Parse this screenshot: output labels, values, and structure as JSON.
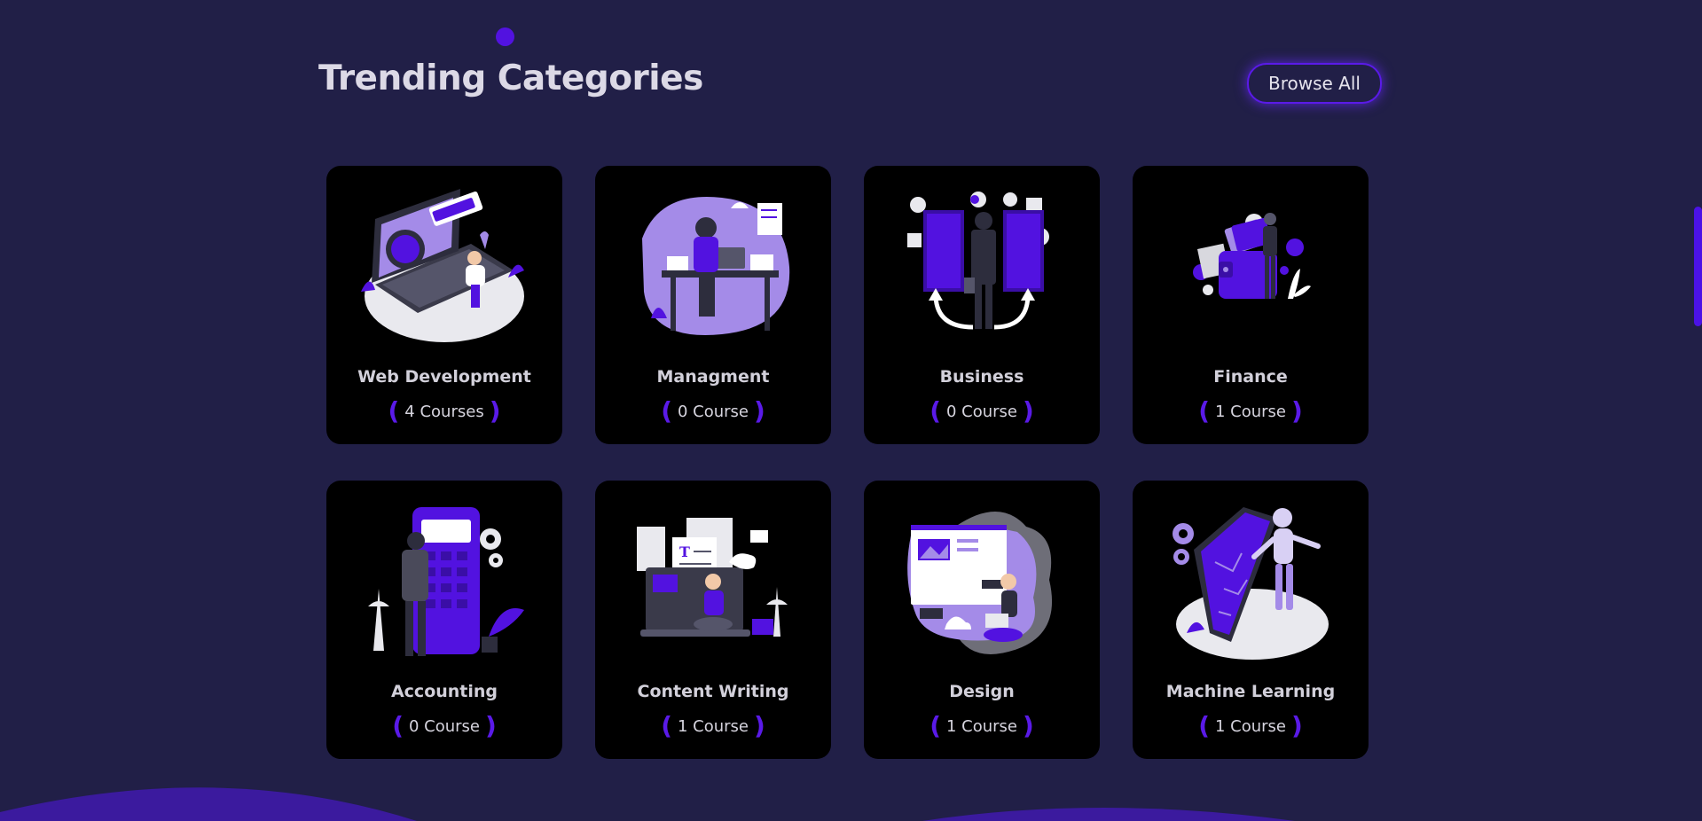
{
  "header": {
    "title": "Trending Categories",
    "browse_label": "Browse All"
  },
  "categories": [
    {
      "title": "Web Development",
      "count": "4 Courses",
      "icon": "laptop-web-illustration"
    },
    {
      "title": "Managment",
      "count": "0 Course",
      "icon": "manager-desk-illustration"
    },
    {
      "title": "Business",
      "count": "0 Course",
      "icon": "business-doors-illustration"
    },
    {
      "title": "Finance",
      "count": "1 Course",
      "icon": "wallet-cards-illustration"
    },
    {
      "title": "Accounting",
      "count": "0 Course",
      "icon": "calculator-illustration"
    },
    {
      "title": "Content Writing",
      "count": "1 Course",
      "icon": "writing-laptop-illustration"
    },
    {
      "title": "Design",
      "count": "1 Course",
      "icon": "design-board-illustration"
    },
    {
      "title": "Machine Learning",
      "count": "1 Course",
      "icon": "robot-phone-illustration"
    }
  ],
  "colors": {
    "background": "#211f47",
    "card": "#000000",
    "accent": "#5212e0",
    "accent_light": "#a48be8",
    "text": "#d2d0da"
  }
}
